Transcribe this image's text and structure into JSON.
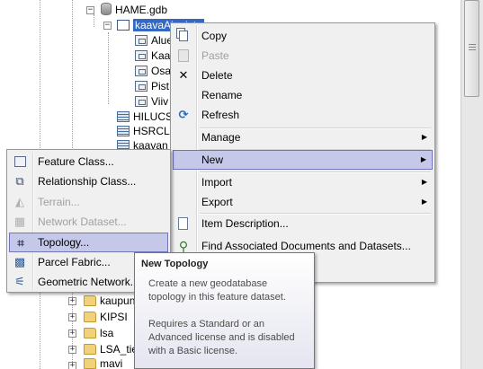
{
  "tree": {
    "gdb": {
      "label": "HAME.gdb",
      "icon": "geodatabase-icon"
    },
    "dataset": {
      "label": "kaavaAineisto",
      "icon": "feature-dataset-icon"
    },
    "feature_classes": [
      {
        "label": "Alue",
        "icon": "polygon-feature-class-icon"
      },
      {
        "label": "Kaa",
        "icon": "polygon-feature-class-icon"
      },
      {
        "label": "Osa",
        "icon": "polygon-feature-class-icon"
      },
      {
        "label": "Pist",
        "icon": "point-feature-class-icon"
      },
      {
        "label": "Viiv",
        "icon": "line-feature-class-icon"
      }
    ],
    "tables": [
      {
        "label": "HILUCS",
        "icon": "table-icon"
      },
      {
        "label": "HSRCL",
        "icon": "table-icon"
      },
      {
        "label": "kaavan",
        "icon": "table-icon"
      }
    ],
    "folders": [
      {
        "label": "kaupun",
        "icon": "folder-icon"
      },
      {
        "label": "KIPSI",
        "icon": "folder-icon"
      },
      {
        "label": "lsa",
        "icon": "folder-icon"
      },
      {
        "label": "LSA_tie",
        "icon": "folder-icon"
      },
      {
        "label": "mavi",
        "icon": "folder-icon"
      }
    ]
  },
  "context_menu": {
    "items": [
      {
        "label": "Copy",
        "icon": "copy-icon",
        "enabled": true
      },
      {
        "label": "Paste",
        "icon": "paste-icon",
        "enabled": false
      },
      {
        "label": "Delete",
        "icon": "delete-icon",
        "enabled": true
      },
      {
        "label": "Rename",
        "icon": "",
        "enabled": true
      },
      {
        "label": "Refresh",
        "icon": "refresh-icon",
        "enabled": true
      },
      {
        "label": "Manage",
        "icon": "",
        "enabled": true,
        "submenu": true
      },
      {
        "label": "New",
        "icon": "",
        "enabled": true,
        "submenu": true,
        "highlighted": true
      },
      {
        "label": "Import",
        "icon": "",
        "enabled": true,
        "submenu": true
      },
      {
        "label": "Export",
        "icon": "",
        "enabled": true,
        "submenu": true
      },
      {
        "label": "Item Description...",
        "icon": "item-description-icon",
        "enabled": true
      },
      {
        "label": "Find Associated Documents and Datasets...",
        "icon": "binoculars-icon",
        "enabled": true
      }
    ]
  },
  "new_submenu": {
    "items": [
      {
        "label": "Feature Class...",
        "icon": "feature-class-icon",
        "enabled": true
      },
      {
        "label": "Relationship Class...",
        "icon": "relationship-class-icon",
        "enabled": true
      },
      {
        "label": "Terrain...",
        "icon": "terrain-icon",
        "enabled": false
      },
      {
        "label": "Network Dataset...",
        "icon": "network-dataset-icon",
        "enabled": false
      },
      {
        "label": "Topology...",
        "icon": "topology-icon",
        "enabled": true,
        "highlighted": true
      },
      {
        "label": "Parcel Fabric...",
        "icon": "parcel-fabric-icon",
        "enabled": true
      },
      {
        "label": "Geometric Network...",
        "icon": "geometric-network-icon",
        "enabled": true
      }
    ]
  },
  "tooltip": {
    "title": "New Topology",
    "line1": "Create a new geodatabase",
    "line2": "topology in this feature dataset.",
    "line3": "Requires a Standard or an",
    "line4": "Advanced license and is disabled",
    "line5": "with a Basic license."
  },
  "colors": {
    "selection": "#3368c3",
    "menu_highlight": "#c5c8e8",
    "menu_highlight_border": "#6f75b8",
    "menu_background": "#f0f0f0"
  }
}
